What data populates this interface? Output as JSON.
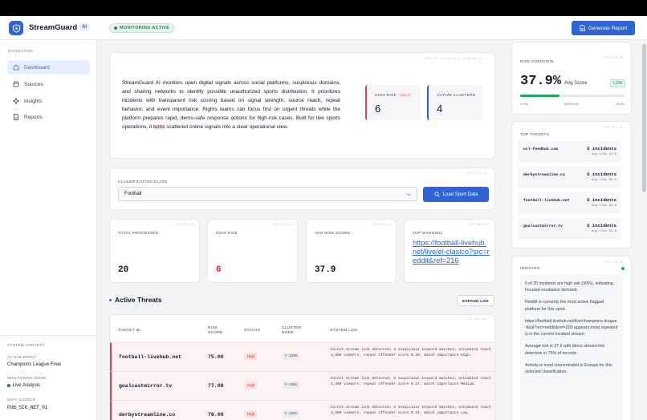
{
  "header": {
    "app_name": "StreamGuard",
    "app_badge": "AI",
    "monitoring_pill": "MONITORING ACTIVE",
    "generate_report": "Generate Report"
  },
  "sidebar": {
    "heading": "NAVIGATION",
    "items": [
      {
        "label": "Dashboard",
        "icon": "home-icon",
        "active": true
      },
      {
        "label": "Sources",
        "icon": "database-icon"
      },
      {
        "label": "Insights",
        "icon": "sparkle-icon"
      },
      {
        "label": "Reports",
        "icon": "document-icon"
      }
    ],
    "context": {
      "heading": "SYSTEM CONTEXT",
      "active_event_label": "ACTIVE EVENT",
      "active_event": "Champions League Final",
      "mode_label": "MONITORING MODE",
      "mode": "Live Analysis",
      "source_label": "DATA SOURCE",
      "source": "PUB_SIG_NET_01"
    }
  },
  "intro": {
    "code": "SYS_ID: SG-AL-01 | 2026-04-19",
    "text_before": "StreamGuard AI monitors open digital signals across social platforms, suspicious domains, and sharing networks to identify possible unauthorized sports distribution. It prioritizes incidents with transparent risk scoring based on signal strength, source reach, repeat behavior, and event importance. Rights teams can focus first on urgent threats while the platform prepares rapid, demo-safe response actions for high-risk cases. Built for live sports operations, it ",
    "highlight": "turns",
    "text_after": " scattered online signals into a clear operational view.",
    "high_risk_label": "HIGH RISK",
    "high_risk_value": "6",
    "high_risk_delta": "+12 ↗",
    "clusters_label": "ACTIVE CLUSTERS",
    "clusters_value": "4"
  },
  "classification": {
    "code": "SYS_CSL_04",
    "label": "CLASSIFICATION CLASS",
    "selected": "Football",
    "load_button": "Load Sport Data"
  },
  "stats": [
    {
      "code": "SYS_PRO_25",
      "label": "TOTAL PROCESSED",
      "value": "20"
    },
    {
      "code": "SYS_RSK_73",
      "label": "HIGH RISK",
      "value": "6"
    },
    {
      "code": "SYS_AVG_18",
      "label": "AVG RISK SCORE",
      "value": "37.9"
    },
    {
      "code": "SYS_WRN_67",
      "label": "TOP WARNING",
      "value": "https://football-livehub.net/live/el-clasico?src=reddit&ref=216"
    }
  ],
  "threats": {
    "title": "Active Threats",
    "expand_button": "EXPAND LOG",
    "code": "SYS_TBL_01",
    "columns": [
      "TARGET ID",
      "RISK SCORE",
      "STATUS",
      "CLUSTER NODE",
      "SYSTEM LOG"
    ],
    "rows": [
      {
        "target": "football-livehub.net",
        "score": "75.00",
        "status": "High",
        "node": "F-1000",
        "log": "Direct stream link detected; 4 suspicious keyword matches; estimated reach 3,000 viewers; repeat offender score 0.20; match importance High."
      },
      {
        "target": "goalcastmirror.tv",
        "score": "77.00",
        "status": "High",
        "node": "F-1001",
        "log": "Direct stream link detected; 5 suspicious keyword matches; estimated reach 3,400 viewers; repeat offender score 0.27; match importance Medium."
      },
      {
        "target": "derbystreamline.co",
        "score": "79.00",
        "status": "High",
        "node": "F-1002",
        "log": "Direct stream link detected; 6 suspicious keyword matches; estimated reach 3,900 viewers; repeat offender score 0.34; match importance Low."
      }
    ]
  },
  "risk_overview": {
    "title": "RISK OVERVIEW",
    "code": "SYS_OVR_08",
    "value": "37.9%",
    "sub": "Avg Score",
    "badge": "LOW",
    "level": 0.379,
    "scale": [
      "LOW",
      "MEDIUM",
      "HIGH"
    ]
  },
  "top_targets": {
    "title": "TOP TARGETS",
    "code": "SYS_TGT_02",
    "items": [
      {
        "domain": "ucl-feedhub.com",
        "count": "5 incidents",
        "risk": "avg risk 42.0"
      },
      {
        "domain": "derbystreamline.co",
        "count": "5 incidents",
        "risk": "avg risk 38.0"
      },
      {
        "domain": "football-livehub.net",
        "count": "5 incidents",
        "risk": "avg risk 35.0"
      },
      {
        "domain": "goalcastmirror.tv",
        "count": "5 incidents",
        "risk": "avg risk 35.6"
      }
    ]
  },
  "insights": {
    "title": "INSIGHTS",
    "code": "SYS_LOG_09",
    "items": [
      "6 of 20 incidents are high risk (30%), indicating focused escalation demand.",
      "Reddit is currently the most active flagged platform for this sport.",
      "https://football-livehub.net/live/champions-league-final?src=reddit&ref=200 appears most repeatedly in the current incident stream.",
      "Average risk is 37.9 with direct stream-link detection in 75% of records.",
      "Activity is most concentrated in Europe for this selected classification."
    ]
  },
  "colors": {
    "accent": "#2f63d6",
    "danger": "#dc2626",
    "success": "#22a55c"
  }
}
